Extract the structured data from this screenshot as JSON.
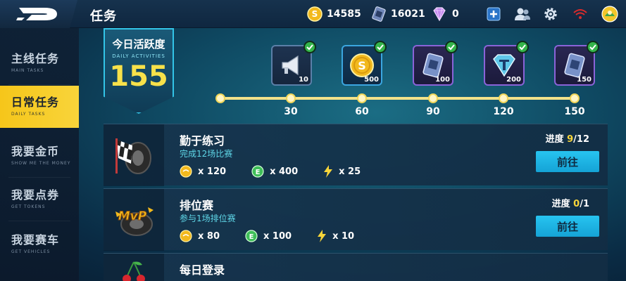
{
  "header": {
    "title": "任务",
    "coins": "14585",
    "cards": "16021",
    "diamonds": "0"
  },
  "icons": {
    "logo": "game-logo-icon",
    "coin": "coin-icon",
    "card": "card-icon",
    "diamond": "diamond-icon",
    "plus": "plus-icon",
    "friends": "friends-icon",
    "settings": "gear-icon",
    "signal": "wifi-signal-icon",
    "avatar": "avatar-icon"
  },
  "colors": {
    "accent_yellow": "#f6c61a",
    "cyan": "#27c4f0",
    "check_green": "#34b54a"
  },
  "sidebar": {
    "items": [
      {
        "label": "主线任务",
        "sub": "MAIN TASKS",
        "active": false
      },
      {
        "label": "日常任务",
        "sub": "DAILY TASKS",
        "active": true
      },
      {
        "label": "我要金币",
        "sub": "SHOW ME THE MONEY",
        "active": false
      },
      {
        "label": "我要点券",
        "sub": "GET TOKENS",
        "active": false
      },
      {
        "label": "我要赛车",
        "sub": "GET VEHICLES",
        "active": false
      }
    ]
  },
  "activity": {
    "title": "今日活跃度",
    "subtitle": "DAILY ACTIVITIES",
    "value": "155"
  },
  "milestones": [
    {
      "threshold": "30",
      "reward_qty": "10",
      "icon": "speaker-icon",
      "claimed": true
    },
    {
      "threshold": "60",
      "reward_qty": "500",
      "icon": "coin-icon",
      "claimed": true
    },
    {
      "threshold": "90",
      "reward_qty": "100",
      "icon": "card-icon",
      "claimed": true
    },
    {
      "threshold": "120",
      "reward_qty": "200",
      "icon": "diamond-card-icon",
      "claimed": true
    },
    {
      "threshold": "150",
      "reward_qty": "150",
      "icon": "card-icon",
      "claimed": true
    }
  ],
  "tasks": [
    {
      "title": "勤于练习",
      "desc": "完成12场比赛",
      "progress_label": "进度",
      "progress_cur": "9",
      "progress_total": "/12",
      "coin_reward": "x 120",
      "exp_reward": "x 400",
      "energy_reward": "x 25",
      "button": "前往",
      "icon": "checkered-flag-tire-icon"
    },
    {
      "title": "排位赛",
      "desc": "参与1场排位赛",
      "progress_label": "进度",
      "progress_cur": "0",
      "progress_total": "/1",
      "coin_reward": "x 80",
      "exp_reward": "x 100",
      "energy_reward": "x 10",
      "button": "前往",
      "icon": "mvp-tire-icon"
    },
    {
      "title": "每日登录",
      "icon": "cherry-icon"
    }
  ]
}
